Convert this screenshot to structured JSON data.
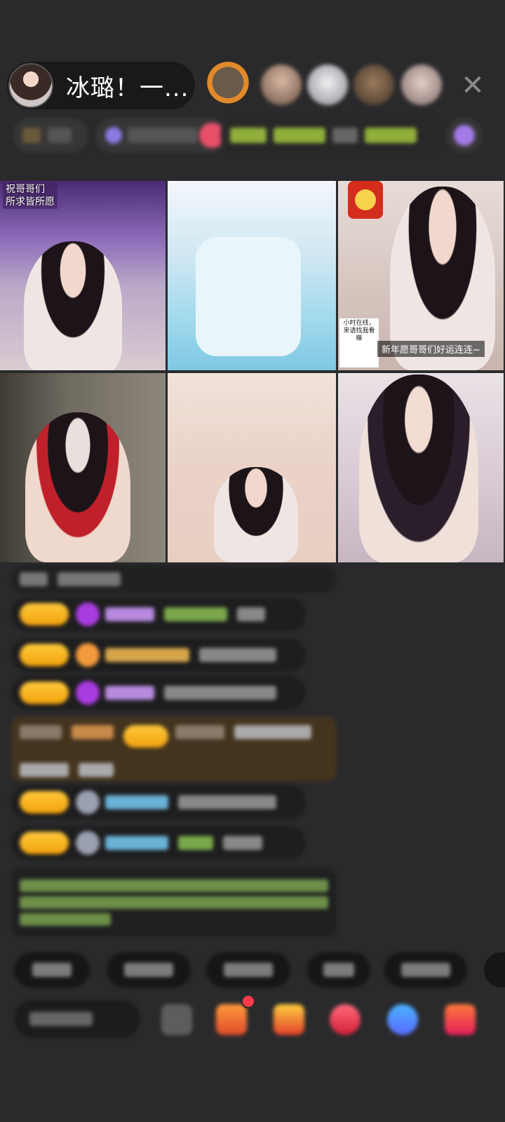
{
  "host": {
    "name": "冰璐！一..."
  },
  "close_icon": "close-icon",
  "info_strip": {
    "rank_label": "",
    "fans_label": "",
    "tags": []
  },
  "tiles": [
    {
      "caption": "祝哥哥们\n所求皆所愿"
    },
    {
      "caption": ""
    },
    {
      "caption": "新年愿哥哥们好运连连~",
      "sign": "小时在线，来请找我看嘛"
    },
    {
      "caption": ""
    },
    {
      "caption": ""
    },
    {
      "caption": ""
    }
  ],
  "colors": {
    "badge_gold": "#f2a20c",
    "gem_purple": "#a93ce0",
    "gem_orange": "#f39a3c",
    "gem_gray": "#9aa0b0",
    "name_purple": "#b88ae0",
    "name_blue": "#6ab3d8",
    "name_gold": "#d6a54a",
    "text_green": "#8fbf5a"
  }
}
